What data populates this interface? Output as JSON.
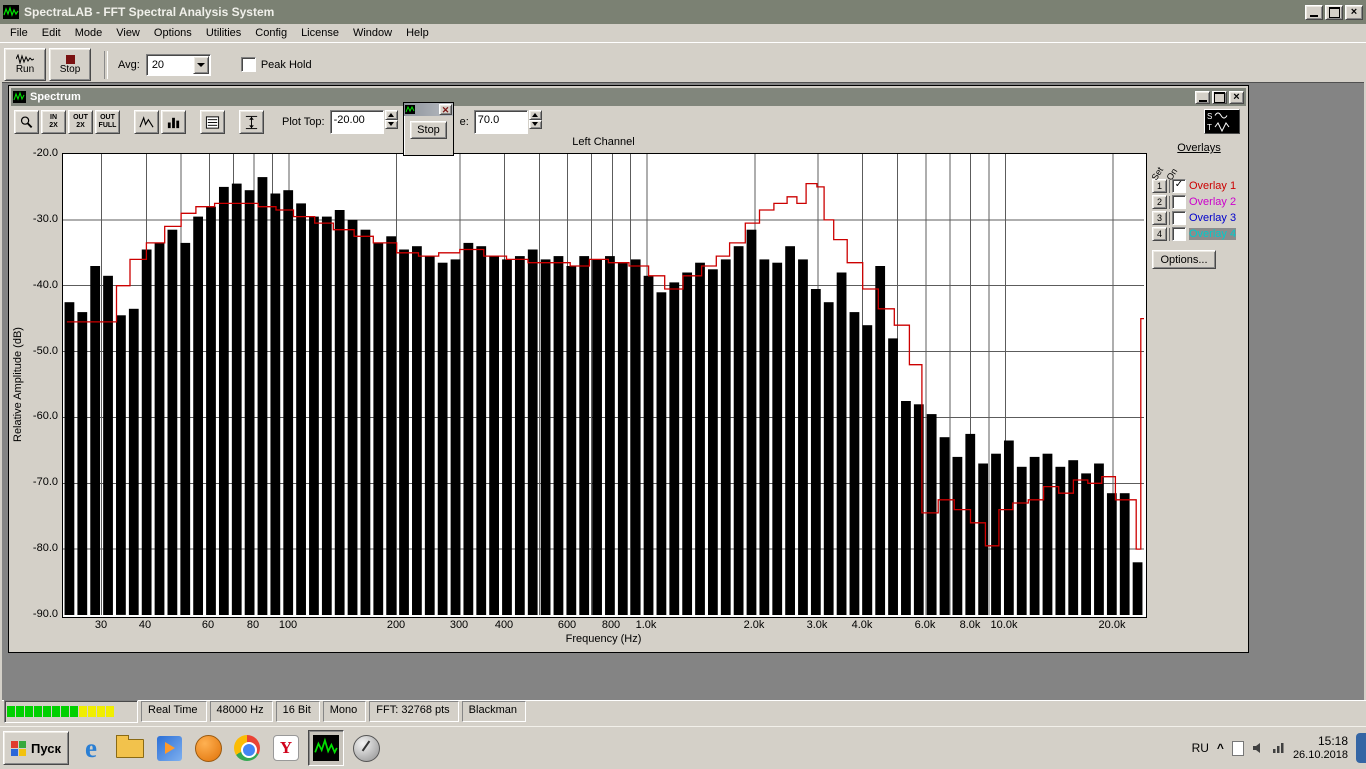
{
  "app": {
    "title": "SpectraLAB - FFT Spectral Analysis System",
    "menu": [
      "File",
      "Edit",
      "Mode",
      "View",
      "Options",
      "Utilities",
      "Config",
      "License",
      "Window",
      "Help"
    ],
    "toolbar": {
      "run_label": "Run",
      "stop_label": "Stop",
      "avg_label": "Avg:",
      "avg_value": "20",
      "peak_hold_label": "Peak Hold"
    }
  },
  "spectrum_window": {
    "title": "Spectrum",
    "toolbar_buttons": [
      {
        "name": "zoom-cursor",
        "glyph": "magnifier"
      },
      {
        "name": "zoom-in-2x",
        "glyph": "text",
        "lines": [
          "IN",
          "2X"
        ]
      },
      {
        "name": "zoom-out-2x",
        "glyph": "text",
        "lines": [
          "OUT",
          "2X"
        ]
      },
      {
        "name": "zoom-out-full",
        "glyph": "text",
        "lines": [
          "OUT",
          "FULL"
        ]
      },
      {
        "name": "peak-curve",
        "glyph": "peak"
      },
      {
        "name": "bar-display",
        "glyph": "bars"
      },
      {
        "name": "data-readout",
        "glyph": "list"
      },
      {
        "name": "amplitude-range",
        "glyph": "vrange"
      }
    ],
    "plot_top_label": "Plot Top:",
    "plot_top_value": "-20.00",
    "plot_range_label_fragment": "e:",
    "plot_range_value": "70.0",
    "floating_stop_label": "Stop",
    "overlays": {
      "heading": "Overlays",
      "col_headers": [
        "Set",
        "On"
      ],
      "rows": [
        {
          "num": "1",
          "label": "Overlay 1",
          "color": "#cc0000",
          "checked": true,
          "selected": false
        },
        {
          "num": "2",
          "label": "Overlay 2",
          "color": "#cc00cc",
          "checked": false,
          "selected": false
        },
        {
          "num": "3",
          "label": "Overlay 3",
          "color": "#0000cc",
          "checked": false,
          "selected": false
        },
        {
          "num": "4",
          "label": "Overlay 4",
          "color": "#00cccc",
          "checked": false,
          "selected": true
        }
      ],
      "options_label": "Options..."
    }
  },
  "chart_data": {
    "type": "bar",
    "title": "Left Channel",
    "xlabel": "Frequency (Hz)",
    "ylabel": "Relative Amplitude (dB)",
    "x_scale": "log",
    "x_range_hz": [
      23.4,
      24400
    ],
    "ylim": [
      -90,
      -20
    ],
    "grid": true,
    "y_ticks": [
      -20,
      -30,
      -40,
      -50,
      -60,
      -70,
      -80,
      -90
    ],
    "x_gridlines": [
      30,
      40,
      50,
      60,
      70,
      80,
      90,
      100,
      200,
      300,
      400,
      500,
      600,
      700,
      800,
      900,
      1000,
      2000,
      3000,
      4000,
      5000,
      6000,
      7000,
      8000,
      9000,
      10000,
      20000
    ],
    "x_tick_labels": [
      {
        "f": 30,
        "label": "30"
      },
      {
        "f": 40,
        "label": "40"
      },
      {
        "f": 60,
        "label": "60"
      },
      {
        "f": 80,
        "label": "80"
      },
      {
        "f": 100,
        "label": "100"
      },
      {
        "f": 200,
        "label": "200"
      },
      {
        "f": 300,
        "label": "300"
      },
      {
        "f": 400,
        "label": "400"
      },
      {
        "f": 600,
        "label": "600"
      },
      {
        "f": 800,
        "label": "800"
      },
      {
        "f": 1000,
        "label": "1.0k"
      },
      {
        "f": 2000,
        "label": "2.0k"
      },
      {
        "f": 3000,
        "label": "3.0k"
      },
      {
        "f": 4000,
        "label": "4.0k"
      },
      {
        "f": 6000,
        "label": "6.0k"
      },
      {
        "f": 8000,
        "label": "8.0k"
      },
      {
        "f": 10000,
        "label": "10.0k"
      },
      {
        "f": 20000,
        "label": "20.0k"
      }
    ],
    "bar_color": "#000000",
    "bars_db": [
      -42.5,
      -44,
      -37,
      -38.5,
      -44.5,
      -43.5,
      -34.5,
      -33.5,
      -31.5,
      -33.5,
      -29.5,
      -28,
      -25,
      -24.5,
      -25.5,
      -23.5,
      -26,
      -25.5,
      -27.5,
      -29.5,
      -29.5,
      -28.5,
      -30,
      -31.5,
      -33.5,
      -32.5,
      -34.5,
      -34,
      -35.5,
      -36.5,
      -36,
      -33.5,
      -34,
      -35.5,
      -36,
      -35.5,
      -34.5,
      -36,
      -35.5,
      -37,
      -35.5,
      -36,
      -35.5,
      -36.5,
      -36,
      -38.5,
      -41,
      -39.5,
      -38,
      -36.5,
      -37.5,
      -36,
      -34,
      -31.5,
      -36,
      -36.5,
      -34,
      -36,
      -40.5,
      -42.5,
      -38,
      -44,
      -46,
      -37,
      -48,
      -57.5,
      -58,
      -59.5,
      -63,
      -66,
      -62.5,
      -67,
      -65.5,
      -63.5,
      -67.5,
      -66,
      -65.5,
      -67.5,
      -66.5,
      -68.5,
      -67,
      -71.5,
      -71.5,
      -82
    ],
    "overlay_line": {
      "name": "Overlay 1",
      "color": "#cc0000",
      "points": [
        [
          24,
          -45.5
        ],
        [
          31,
          -45.5
        ],
        [
          33,
          -40
        ],
        [
          36,
          -36
        ],
        [
          40,
          -33.5
        ],
        [
          45,
          -31
        ],
        [
          50,
          -29
        ],
        [
          55,
          -28
        ],
        [
          62,
          -27.5
        ],
        [
          72,
          -27.5
        ],
        [
          82,
          -28
        ],
        [
          92,
          -28.5
        ],
        [
          103,
          -29.5
        ],
        [
          118,
          -30.5
        ],
        [
          133,
          -31.5
        ],
        [
          152,
          -32.5
        ],
        [
          172,
          -33.5
        ],
        [
          200,
          -35
        ],
        [
          230,
          -35.5
        ],
        [
          262,
          -35
        ],
        [
          300,
          -34.5
        ],
        [
          350,
          -35.5
        ],
        [
          405,
          -36
        ],
        [
          465,
          -36.5
        ],
        [
          535,
          -36.5
        ],
        [
          610,
          -37
        ],
        [
          690,
          -36
        ],
        [
          780,
          -36.5
        ],
        [
          890,
          -37
        ],
        [
          1010,
          -38.5
        ],
        [
          1120,
          -40.5
        ],
        [
          1260,
          -38.5
        ],
        [
          1420,
          -37
        ],
        [
          1560,
          -35.5
        ],
        [
          1700,
          -33.5
        ],
        [
          1880,
          -30.5
        ],
        [
          2060,
          -28.5
        ],
        [
          2260,
          -27.5
        ],
        [
          2460,
          -26.5
        ],
        [
          2620,
          -27.5
        ],
        [
          2780,
          -24.5
        ],
        [
          2980,
          -25
        ],
        [
          3120,
          -30
        ],
        [
          3320,
          -33
        ],
        [
          3620,
          -36.5
        ],
        [
          4000,
          -40.5
        ],
        [
          4420,
          -43.5
        ],
        [
          4900,
          -46
        ],
        [
          5400,
          -52
        ],
        [
          5850,
          -74.5
        ],
        [
          6500,
          -72.5
        ],
        [
          7200,
          -74
        ],
        [
          8000,
          -76
        ],
        [
          8800,
          -79.5
        ],
        [
          9600,
          -74
        ],
        [
          10500,
          -73
        ],
        [
          11600,
          -72.5
        ],
        [
          12800,
          -70.5
        ],
        [
          14100,
          -71.5
        ],
        [
          15500,
          -69.5
        ],
        [
          17000,
          -70
        ],
        [
          18600,
          -69
        ],
        [
          20300,
          -72.5
        ],
        [
          22000,
          -72.5
        ],
        [
          23200,
          -80
        ],
        [
          23900,
          -45
        ]
      ]
    }
  },
  "status_bar": {
    "meter": {
      "green_blocks": 8,
      "yellow_blocks": 4
    },
    "panels": [
      "Real Time",
      "48000 Hz",
      "16 Bit",
      "Mono",
      "FFT: 32768 pts",
      "Blackman"
    ]
  },
  "taskbar": {
    "start_label": "Пуск",
    "quicklaunch": [
      "internet-explorer",
      "file-explorer",
      "media-player",
      "orange-app",
      "chrome",
      "yandex-browser",
      "spectralab",
      "audio-app"
    ],
    "tray": {
      "language": "RU",
      "time": "15:18",
      "date": "26.10.2018"
    }
  }
}
